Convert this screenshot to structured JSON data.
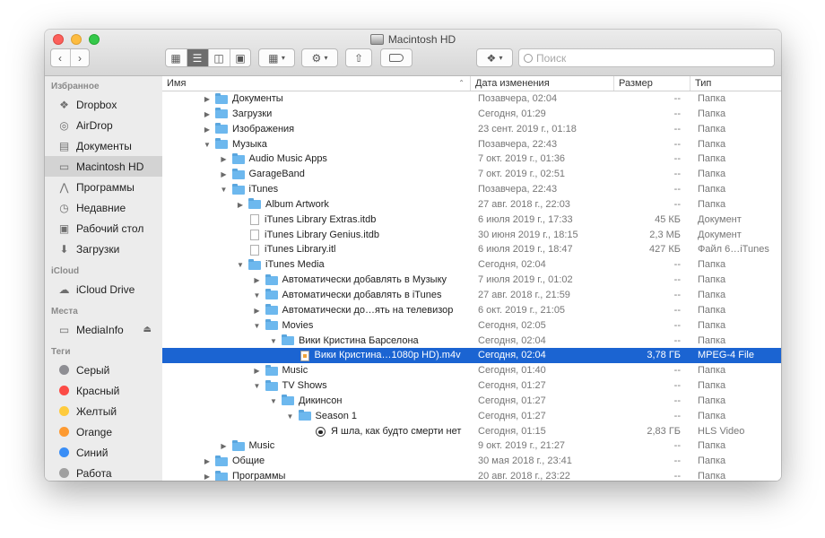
{
  "window": {
    "title": "Macintosh HD"
  },
  "toolbar": {
    "search_placeholder": "Поиск"
  },
  "sidebar": {
    "favorites_header": "Избранное",
    "favorites": [
      {
        "label": "Dropbox",
        "icon": "dropbox-icon"
      },
      {
        "label": "AirDrop",
        "icon": "airdrop-icon"
      },
      {
        "label": "Документы",
        "icon": "documents-icon"
      },
      {
        "label": "Macintosh HD",
        "icon": "hard-drive-icon",
        "selected": true
      },
      {
        "label": "Программы",
        "icon": "applications-icon"
      },
      {
        "label": "Недавние",
        "icon": "recents-icon"
      },
      {
        "label": "Рабочий стол",
        "icon": "desktop-icon"
      },
      {
        "label": "Загрузки",
        "icon": "downloads-icon"
      }
    ],
    "icloud_header": "iCloud",
    "icloud": [
      {
        "label": "iCloud Drive",
        "icon": "cloud-icon"
      }
    ],
    "places_header": "Места",
    "places": [
      {
        "label": "MediaInfo",
        "icon": "drive-icon"
      }
    ],
    "tags_header": "Теги",
    "tags": [
      {
        "label": "Серый",
        "color": "#8e8e93"
      },
      {
        "label": "Красный",
        "color": "#fc4b46"
      },
      {
        "label": "Желтый",
        "color": "#fecb3d"
      },
      {
        "label": "Orange",
        "color": "#fd9a31"
      },
      {
        "label": "Синий",
        "color": "#3a8ef6"
      },
      {
        "label": "Работа",
        "color": "#a0a0a0"
      }
    ]
  },
  "columns": {
    "name": "Имя",
    "date": "Дата изменения",
    "size": "Размер",
    "kind": "Тип"
  },
  "rows": [
    {
      "depth": 0,
      "disclosure": "closed",
      "icon": "folder-icon",
      "name": "Документы",
      "date": "Позавчера, 02:04",
      "size": "--",
      "kind": "Папка"
    },
    {
      "depth": 0,
      "disclosure": "closed",
      "icon": "folder-icon",
      "name": "Загрузки",
      "date": "Сегодня, 01:29",
      "size": "--",
      "kind": "Папка"
    },
    {
      "depth": 0,
      "disclosure": "closed",
      "icon": "folder-icon",
      "name": "Изображения",
      "date": "23 сент. 2019 г., 01:18",
      "size": "--",
      "kind": "Папка"
    },
    {
      "depth": 0,
      "disclosure": "open",
      "icon": "folder-icon",
      "name": "Музыка",
      "date": "Позавчера, 22:43",
      "size": "--",
      "kind": "Папка"
    },
    {
      "depth": 1,
      "disclosure": "closed",
      "icon": "folder-icon",
      "name": "Audio Music Apps",
      "date": "7 окт. 2019 г., 01:36",
      "size": "--",
      "kind": "Папка"
    },
    {
      "depth": 1,
      "disclosure": "closed",
      "icon": "folder-icon",
      "name": "GarageBand",
      "date": "7 окт. 2019 г., 02:51",
      "size": "--",
      "kind": "Папка"
    },
    {
      "depth": 1,
      "disclosure": "open",
      "icon": "folder-icon",
      "name": "iTunes",
      "date": "Позавчера, 22:43",
      "size": "--",
      "kind": "Папка"
    },
    {
      "depth": 2,
      "disclosure": "closed",
      "icon": "folder-icon",
      "name": "Album Artwork",
      "date": "27 авг. 2018 г., 22:03",
      "size": "--",
      "kind": "Папка"
    },
    {
      "depth": 2,
      "disclosure": "none",
      "icon": "document-icon",
      "name": "iTunes Library Extras.itdb",
      "date": "6 июля 2019 г., 17:33",
      "size": "45 КБ",
      "kind": "Документ"
    },
    {
      "depth": 2,
      "disclosure": "none",
      "icon": "document-icon",
      "name": "iTunes Library Genius.itdb",
      "date": "30 июня 2019 г., 18:15",
      "size": "2,3 МБ",
      "kind": "Документ"
    },
    {
      "depth": 2,
      "disclosure": "none",
      "icon": "document-icon",
      "name": "iTunes Library.itl",
      "date": "6 июля 2019 г., 18:47",
      "size": "427 КБ",
      "kind": "Файл 6…iTunes"
    },
    {
      "depth": 2,
      "disclosure": "open",
      "icon": "folder-icon",
      "name": "iTunes Media",
      "date": "Сегодня, 02:04",
      "size": "--",
      "kind": "Папка"
    },
    {
      "depth": 3,
      "disclosure": "closed",
      "icon": "folder-icon",
      "name": "Автоматически добавлять в Музыку",
      "date": "7 июля 2019 г., 01:02",
      "size": "--",
      "kind": "Папка"
    },
    {
      "depth": 3,
      "disclosure": "open",
      "icon": "folder-icon",
      "name": "Автоматически добавлять в iTunes",
      "date": "27 авг. 2018 г., 21:59",
      "size": "--",
      "kind": "Папка"
    },
    {
      "depth": 3,
      "disclosure": "closed",
      "icon": "folder-icon",
      "name": "Автоматически до…ять на телевизор",
      "date": "6 окт. 2019 г., 21:05",
      "size": "--",
      "kind": "Папка"
    },
    {
      "depth": 3,
      "disclosure": "open",
      "icon": "folder-icon",
      "name": "Movies",
      "date": "Сегодня, 02:05",
      "size": "--",
      "kind": "Папка"
    },
    {
      "depth": 4,
      "disclosure": "open",
      "icon": "folder-icon",
      "name": "Вики Кристина Барселона",
      "date": "Сегодня, 02:04",
      "size": "--",
      "kind": "Папка"
    },
    {
      "depth": 5,
      "disclosure": "none",
      "icon": "movie-file-icon",
      "name": "Вики Кристина…1080p HD).m4v",
      "date": "Сегодня, 02:04",
      "size": "3,78 ГБ",
      "kind": "MPEG-4 File",
      "selected": true
    },
    {
      "depth": 3,
      "disclosure": "closed",
      "icon": "folder-icon",
      "name": "Music",
      "date": "Сегодня, 01:40",
      "size": "--",
      "kind": "Папка"
    },
    {
      "depth": 3,
      "disclosure": "open",
      "icon": "folder-icon",
      "name": "TV Shows",
      "date": "Сегодня, 01:27",
      "size": "--",
      "kind": "Папка"
    },
    {
      "depth": 4,
      "disclosure": "open",
      "icon": "folder-icon",
      "name": "Дикинсон",
      "date": "Сегодня, 01:27",
      "size": "--",
      "kind": "Папка"
    },
    {
      "depth": 5,
      "disclosure": "open",
      "icon": "folder-icon",
      "name": "Season 1",
      "date": "Сегодня, 01:27",
      "size": "--",
      "kind": "Папка"
    },
    {
      "depth": 6,
      "disclosure": "none",
      "icon": "hls-video-icon",
      "name": "Я шла, как будто смерти нет",
      "date": "Сегодня, 01:15",
      "size": "2,83 ГБ",
      "kind": "HLS Video"
    },
    {
      "depth": 1,
      "disclosure": "closed",
      "icon": "folder-icon",
      "name": "Music",
      "date": "9 окт. 2019 г., 21:27",
      "size": "--",
      "kind": "Папка"
    },
    {
      "depth": 0,
      "disclosure": "closed",
      "icon": "folder-icon",
      "name": "Общие",
      "date": "30 мая 2018 г., 23:41",
      "size": "--",
      "kind": "Папка"
    },
    {
      "depth": 0,
      "disclosure": "closed",
      "icon": "folder-icon",
      "name": "Программы",
      "date": "20 авг. 2018 г., 23:22",
      "size": "--",
      "kind": "Папка"
    }
  ]
}
